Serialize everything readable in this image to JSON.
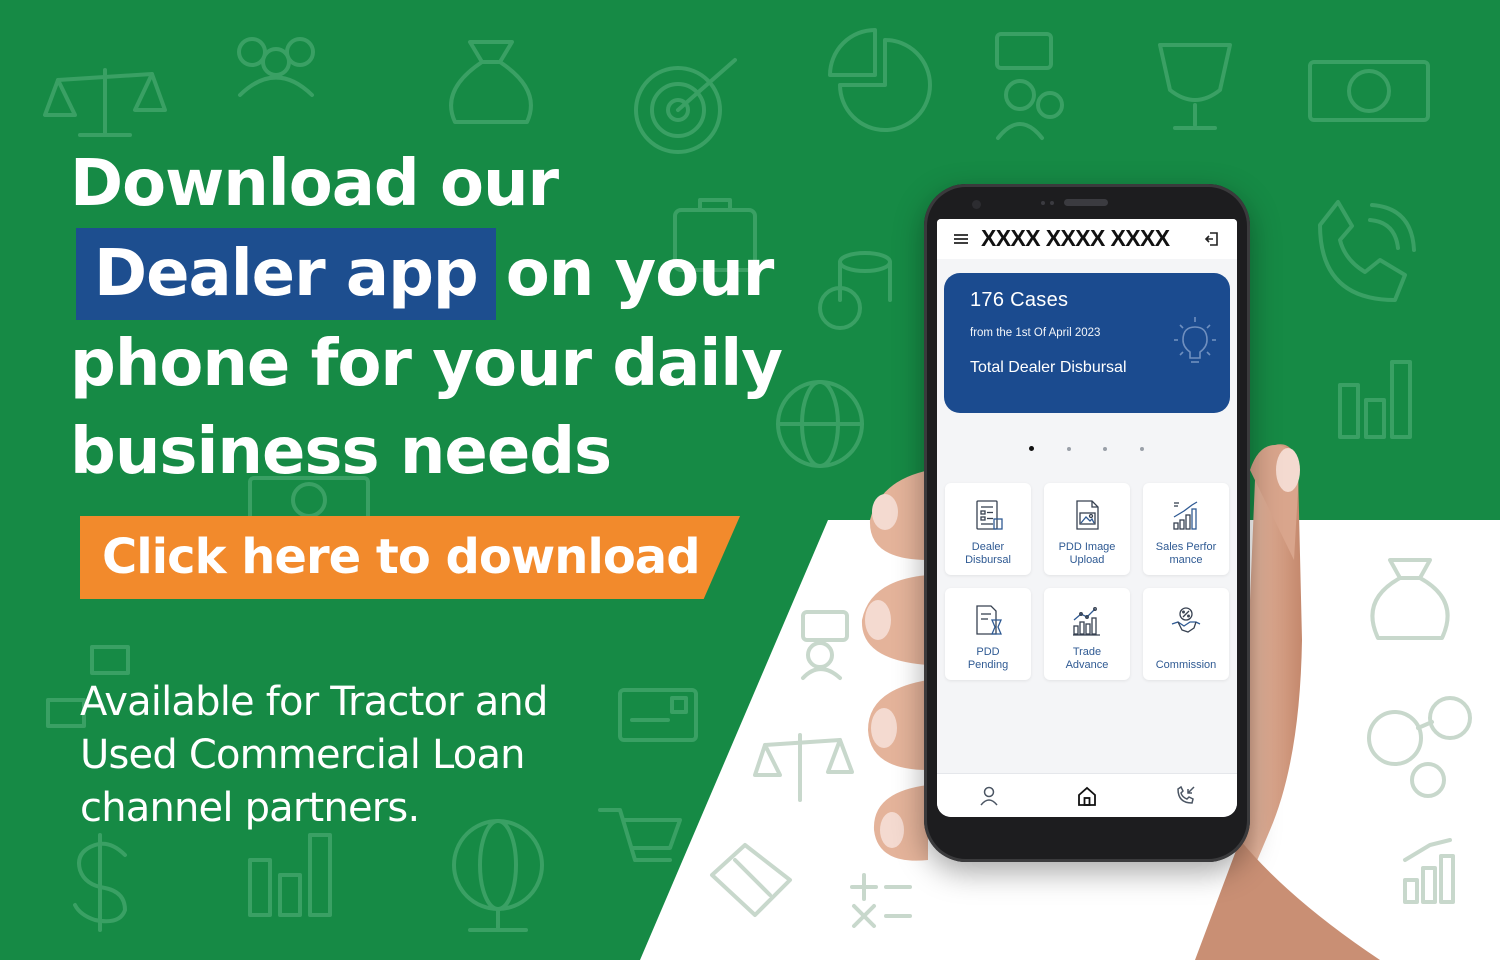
{
  "headline": {
    "line1": "Download our",
    "highlight": "Dealer app",
    "line2_rest": "on your",
    "line3": "phone for your daily",
    "line4": "business needs"
  },
  "cta": {
    "label": "Click here to download"
  },
  "availability": {
    "line1": "Available for Tractor and",
    "line2": "Used Commercial Loan",
    "line3": "channel partners."
  },
  "colors": {
    "green": "#168a45",
    "blue": "#1d4e8f",
    "orange": "#f28a2c",
    "white": "#ffffff"
  },
  "phone": {
    "app_title": "XXXX XXXX XXXX",
    "banner": {
      "cases": "176  Cases",
      "subtitle": "from the 1st Of April 2023",
      "label": "Total Dealer Disbursal"
    },
    "carousel": {
      "count": 4,
      "active": 0
    },
    "tiles": [
      {
        "line1": "Dealer",
        "line2": "Disbursal",
        "icon": "document-list-icon"
      },
      {
        "line1": "PDD Image",
        "line2": "Upload",
        "icon": "image-upload-icon"
      },
      {
        "line1": "Sales Perfor",
        "line2": "mance",
        "icon": "bar-growth-icon"
      },
      {
        "line1": "PDD",
        "line2": "Pending",
        "icon": "hourglass-document-icon"
      },
      {
        "line1": "Trade",
        "line2": "Advance",
        "icon": "chart-trend-icon"
      },
      {
        "line1": "",
        "line2": "Commission",
        "icon": "handshake-percent-icon"
      }
    ],
    "nav": [
      "profile-icon",
      "home-icon",
      "phone-call-icon"
    ]
  }
}
